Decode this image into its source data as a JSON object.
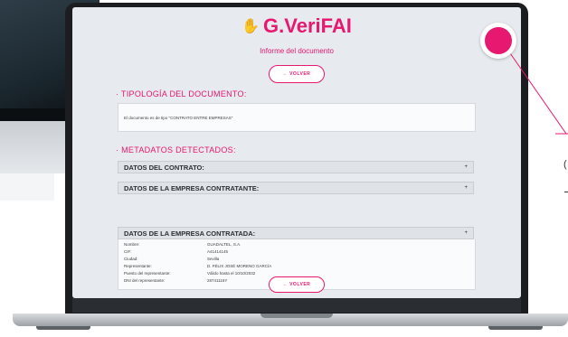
{
  "app": {
    "logo_text": "G.VeriFAI",
    "logo_icon": "hand-icon",
    "subtitle": "Informe del documento",
    "accent_color": "#e6186f"
  },
  "buttons": {
    "back_top": "← VOLVER",
    "back_bottom": "← VOLVER"
  },
  "tipologia": {
    "title": "· TIPOLOGÍA DEL DOCUMENTO:",
    "text": "El documento es de tipo \"CONTRATO ENTRE EMPRESAS\""
  },
  "metadatos": {
    "title": "· METADATOS DETECTADOS:",
    "sections": [
      {
        "label": "DATOS DEL CONTRATO:",
        "toggle": "+"
      },
      {
        "label": "DATOS DE LA EMPRESA CONTRATANTE:",
        "toggle": "+"
      },
      {
        "label": "DATOS DE LA EMPRESA CONTRATADA:",
        "toggle": "+"
      }
    ],
    "contratada_rows": [
      {
        "key": "Nombre:",
        "value": "GUADALTEL, S.A."
      },
      {
        "key": "CIF:",
        "value": "A41414145"
      },
      {
        "key": "Ciudad:",
        "value": "Sevilla"
      },
      {
        "key": "Representante:",
        "value": "D. FÉLIX JOSÉ MORENO GARCÍA"
      },
      {
        "key": "Puesto del representante:",
        "value": "Válido hasta el 10/10/2032"
      },
      {
        "key": "DNI del representante:",
        "value": "28741116Y"
      }
    ]
  },
  "edge_text": "("
}
